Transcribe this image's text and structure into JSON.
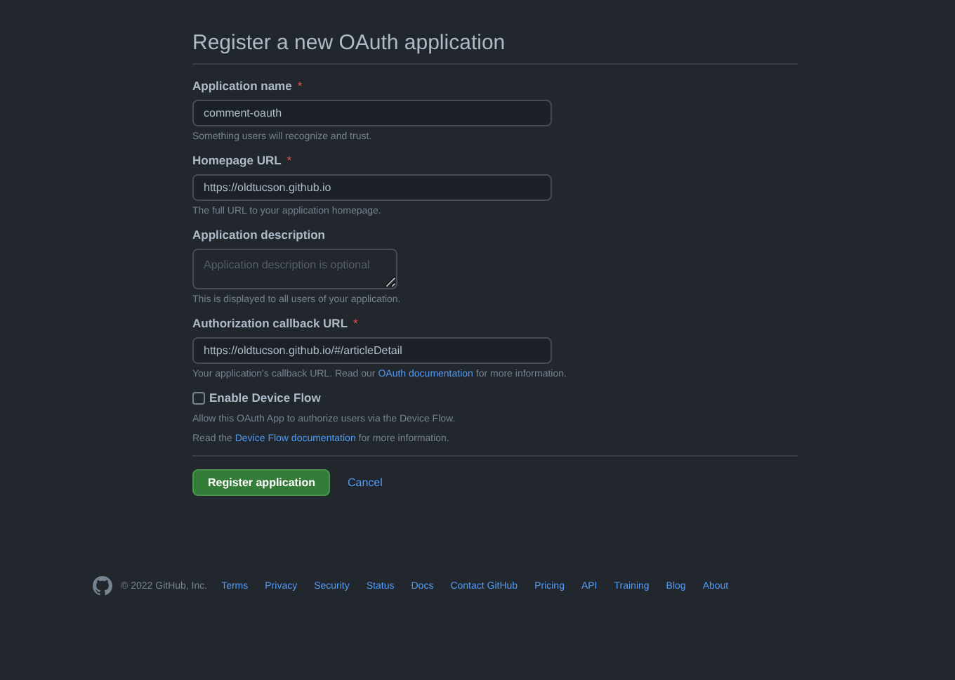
{
  "title": "Register a new OAuth application",
  "fields": [
    {
      "kind": "input",
      "label": "Application name",
      "required": true,
      "value": "comment-oauth",
      "hint": {
        "before": "Something users will recognize and trust."
      }
    },
    {
      "kind": "input",
      "label": "Homepage URL",
      "required": true,
      "value": "https://oldtucson.github.io",
      "hint": {
        "before": "The full URL to your application homepage."
      }
    },
    {
      "kind": "textarea",
      "label": "Application description",
      "required": false,
      "placeholder": "Application description is optional",
      "hint": {
        "before": "This is displayed to all users of your application."
      }
    },
    {
      "kind": "input",
      "label": "Authorization callback URL",
      "required": true,
      "value": "https://oldtucson.github.io/#/articleDetail",
      "hint": {
        "before": "Your application's callback URL. Read our ",
        "link": "OAuth documentation",
        "after": " for more information."
      }
    }
  ],
  "device_flow": {
    "label": "Enable Device Flow",
    "checked": false,
    "notes": [
      {
        "before": "Allow this OAuth App to authorize users via the Device Flow."
      },
      {
        "before": "Read the ",
        "link": "Device Flow documentation",
        "after": " for more information."
      }
    ]
  },
  "required_mark": "*",
  "buttons": {
    "submit": "Register application",
    "cancel": "Cancel"
  },
  "footer": {
    "copyright": "© 2022 GitHub, Inc.",
    "links": [
      "Terms",
      "Privacy",
      "Security",
      "Status",
      "Docs",
      "Contact GitHub",
      "Pricing",
      "API",
      "Training",
      "Blog",
      "About"
    ]
  }
}
